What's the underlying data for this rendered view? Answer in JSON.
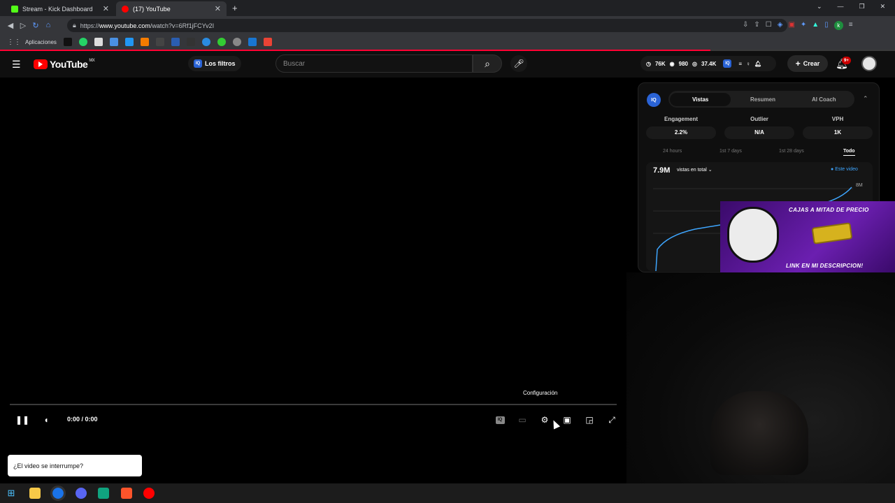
{
  "browser": {
    "tabs": [
      {
        "title": "Stream - Kick Dashboard",
        "icon": "kick-icon",
        "color": "#53fc18"
      },
      {
        "title": "(17) YouTube",
        "icon": "youtube-icon",
        "color": "#ff0000"
      }
    ],
    "new_tab": "+",
    "url_prefix": "https://",
    "url_domain": "www.youtube.com",
    "url_path": "/watch?v=6Rf1jFCYv2I",
    "bookmarks_label": "Aplicaciones"
  },
  "youtube": {
    "logo_text": "YouTube",
    "region": "MX",
    "filters_label": "Los filtros",
    "filters_badge": "IQ",
    "search_placeholder": "Buscar",
    "stats": {
      "views": "76K",
      "likes": "980",
      "watch": "37.4K"
    },
    "create_label": "Crear",
    "notif_count": "9+"
  },
  "player": {
    "time": "0:00 / 0:00",
    "tooltip": "Configuración",
    "hint": "¿El video se interrumpe?"
  },
  "panel": {
    "badge": "IQ",
    "tabs": [
      "Vistas",
      "Resumen",
      "AI Coach"
    ],
    "metrics": [
      {
        "label": "Engagement",
        "value": "2.2%"
      },
      {
        "label": "Outlier",
        "value": "N/A"
      },
      {
        "label": "VPH",
        "value": "1K"
      }
    ],
    "ranges": [
      "24 hours",
      "1st 7 days",
      "1st 28 days",
      "Todo"
    ],
    "total": "7.9M",
    "total_label": "vistas en total",
    "legend": "Este video",
    "y_tick": "8M"
  },
  "ad": {
    "line1": "CAJAS A MITAD DE PRECIO",
    "line2": "LINK EN MI DESCRIPCION!"
  },
  "colors": {
    "accent_red": "#ff0000",
    "accent_blue": "#3ea6ff",
    "iq_blue": "#2a63d6"
  }
}
